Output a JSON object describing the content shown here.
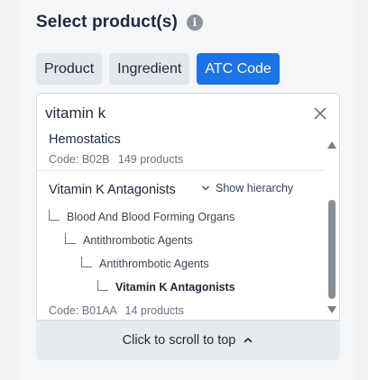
{
  "header": {
    "title": "Select product(s)",
    "info_glyph": "i",
    "info_icon": "info-icon"
  },
  "tabs": [
    {
      "label": "Product",
      "active": false
    },
    {
      "label": "Ingredient",
      "active": false
    },
    {
      "label": "ATC Code",
      "active": true
    }
  ],
  "search": {
    "value": "vitamin k",
    "clear_icon": "close-icon"
  },
  "results": {
    "items": [
      {
        "title": "Hemostatics",
        "code": "Code: B02B",
        "count": "149 products"
      },
      {
        "title": "Vitamin K Antagonists",
        "action": "Show hierarchy",
        "hierarchy": [
          "Blood And Blood Forming Organs",
          "Antithrombotic Agents",
          "Antithrombotic Agents",
          "Vitamin K Antagonists"
        ],
        "code": "Code: B01AA",
        "count": "14 products"
      }
    ]
  },
  "footer": {
    "scroll_top_label": "Click to scroll to top"
  },
  "colors": {
    "accent": "#1a73e8",
    "tab_bg": "#e3e6ea",
    "panel_bg": "#f4f6f8"
  }
}
